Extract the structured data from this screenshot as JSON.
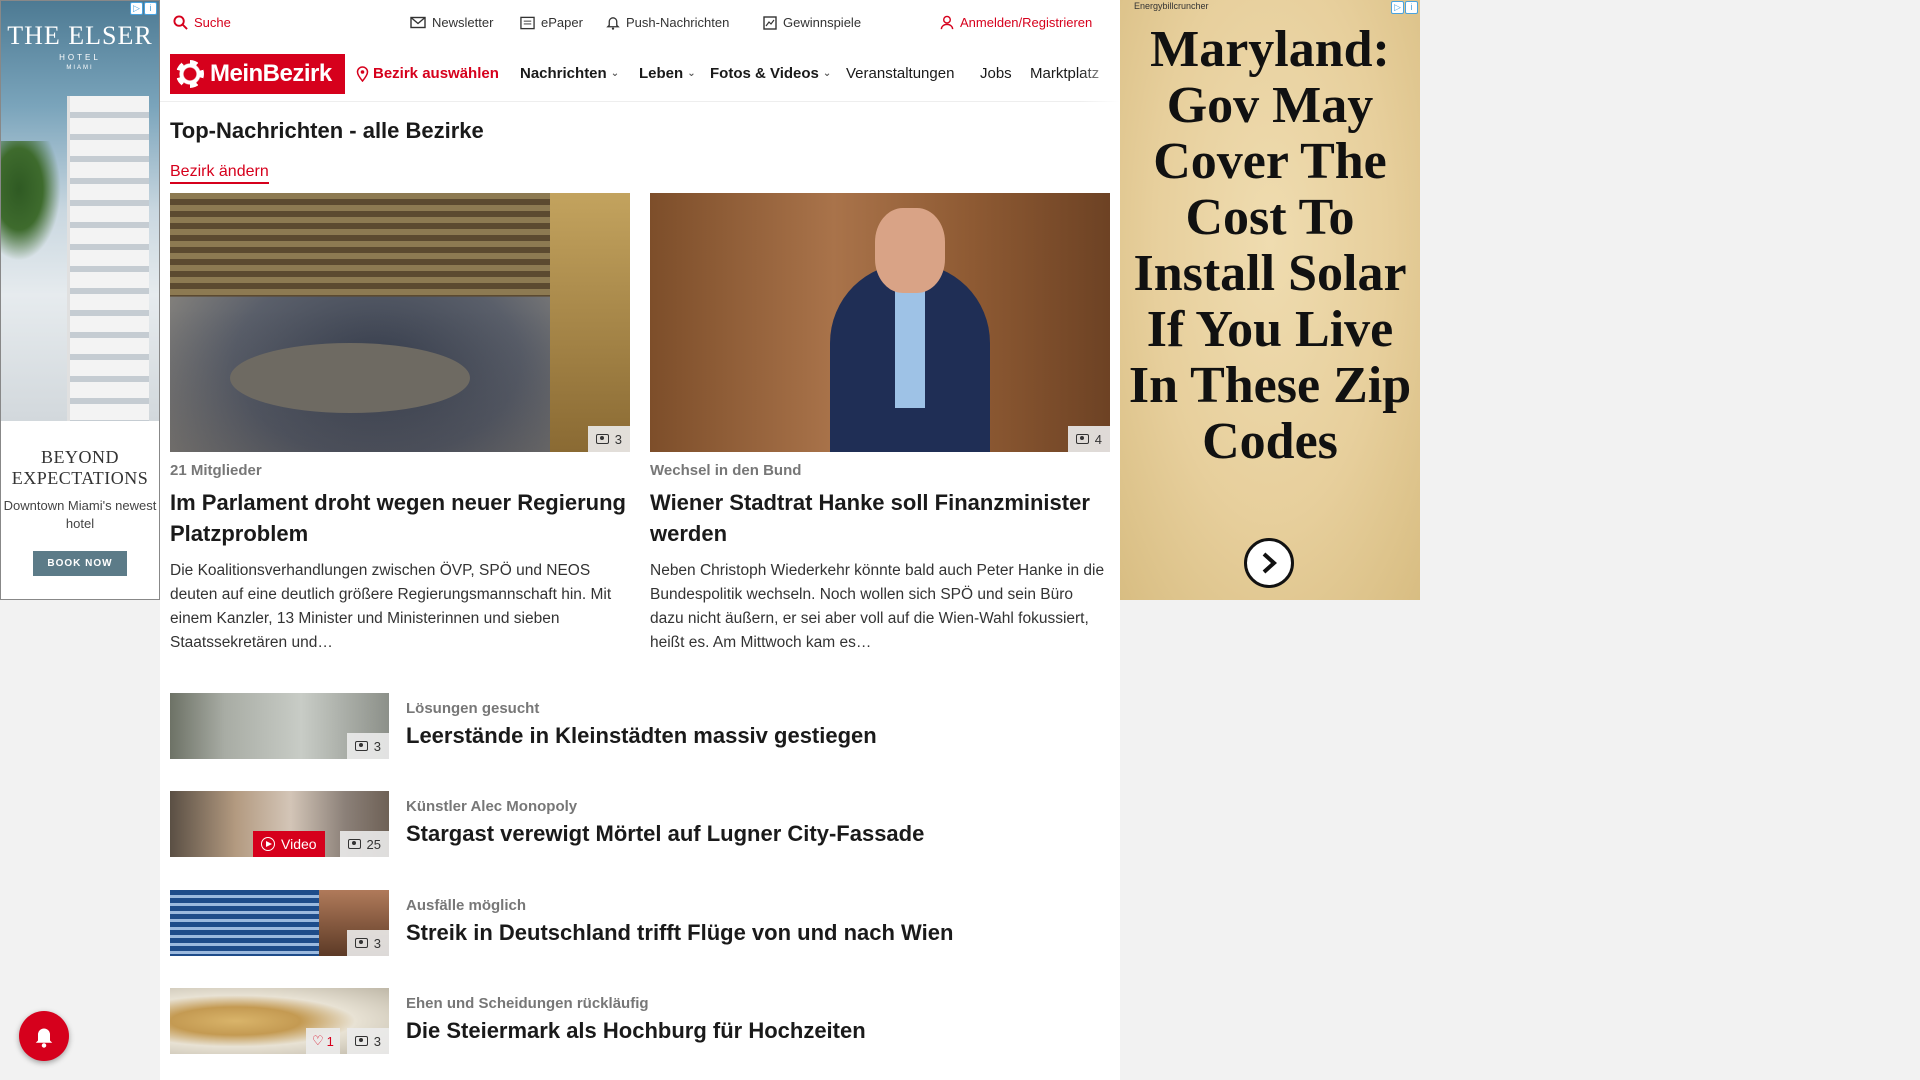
{
  "utility": {
    "search": "Suche",
    "newsletter": "Newsletter",
    "epaper": "ePaper",
    "push": "Push-Nachrichten",
    "contests": "Gewinnspiele",
    "login": "Anmelden/Registrieren"
  },
  "nav": {
    "logo": "MeinBezirk",
    "district": "Bezirk auswählen",
    "items": [
      "Nachrichten",
      "Leben",
      "Fotos & Videos",
      "Veranstaltungen",
      "Jobs",
      "Marktplatz"
    ]
  },
  "section": {
    "title": "Top-Nachrichten - alle Bezirke",
    "change": "Bezirk ändern"
  },
  "featured": [
    {
      "kicker": "21 Mitglieder",
      "title": "Im Parlament droht wegen neuer Regierung Platzproblem",
      "teaser": "Die Koalitionsverhandlungen zwischen ÖVP, SPÖ und NEOS deuten auf eine deutlich größere Regierungsmannschaft hin. Mit einem Kanzler, 13 Minister und Ministerinnen und sieben Staatssekretären und…",
      "photos": "3"
    },
    {
      "kicker": "Wechsel in den Bund",
      "title": "Wiener Stadtrat Hanke soll Finanzminister werden",
      "teaser": "Neben Christoph Wiederkehr könnte bald auch Peter Hanke in die Bundespolitik wechseln. Noch wollen sich SPÖ und sein Büro dazu nicht äußern, er sei aber voll auf die Wien-Wahl fokussiert, heißt es. Am Mittwoch kam es…",
      "photos": "4"
    }
  ],
  "list": [
    {
      "kicker": "Lösungen gesucht",
      "title": "Leerstände in Kleinstädten massiv gestiegen",
      "photos": "3"
    },
    {
      "kicker": "Künstler Alec Monopoly",
      "title": "Stargast verewigt Mörtel auf Lugner City-Fassade",
      "photos": "25",
      "video": "Video"
    },
    {
      "kicker": "Ausfälle möglich",
      "title": "Streik in Deutschland trifft Flüge von und nach Wien",
      "photos": "3"
    },
    {
      "kicker": "Ehen und Scheidungen rückläufig",
      "title": "Die Steiermark als Hochburg für Hochzeiten",
      "photos": "3",
      "likes": "1"
    }
  ],
  "ad_left": {
    "brand": "THE ELSER",
    "brand_sub": "HOTEL",
    "brand_city": "MIAMI",
    "beyond": "BEYOND EXPECTATIONS",
    "desc": "Downtown Miami's newest hotel",
    "cta": "BOOK NOW"
  },
  "ad_right": {
    "source": "Energybillcruncher",
    "headline": "Maryland: Gov May Cover The Cost To Install Solar If You Live In These Zip Codes"
  },
  "colors": {
    "brand": "#d6001c",
    "ad_bg": "#e7cf9c"
  }
}
